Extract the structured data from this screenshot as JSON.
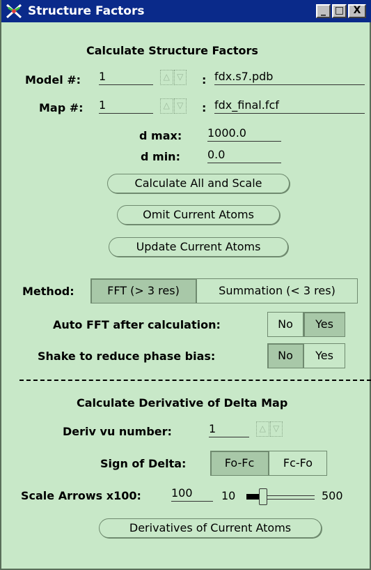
{
  "window": {
    "title": "Structure Factors",
    "btn_min": "_",
    "btn_max": "□",
    "btn_close": "X"
  },
  "section1": {
    "heading": "Calculate Structure Factors",
    "model_label": "Model #:",
    "model_value": "1",
    "model_file": "fdx.s7.pdb",
    "map_label": "Map #:",
    "map_value": "1",
    "map_file": "fdx_final.fcf",
    "colon": ":",
    "dmax_label": "d max:",
    "dmax_value": "1000.0",
    "dmin_label": "d min:",
    "dmin_value": "0.0",
    "btn_calc_all": "Calculate All and Scale",
    "btn_omit": "Omit Current Atoms",
    "btn_update": "Update Current Atoms"
  },
  "method": {
    "label": "Method:",
    "opt1": "FFT (> 3 res)",
    "opt2": "Summation (< 3 res)",
    "selected": "FFT (> 3 res)"
  },
  "auto_fft": {
    "label": "Auto FFT after calculation:",
    "no": "No",
    "yes": "Yes",
    "selected": "Yes"
  },
  "shake": {
    "label": "Shake to reduce phase bias:",
    "no": "No",
    "yes": "Yes",
    "selected": "No"
  },
  "section2": {
    "heading": "Calculate Derivative of Delta Map",
    "deriv_label": "Deriv vu number:",
    "deriv_value": "1",
    "sign_label": "Sign of Delta:",
    "sign_opt1": "Fo-Fc",
    "sign_opt2": "Fc-Fo",
    "sign_selected": "Fo-Fc",
    "scale_label": "Scale Arrows x100:",
    "scale_value": "100",
    "slider_min": "10",
    "slider_max": "500",
    "btn_derivatives": "Derivatives of Current Atoms"
  },
  "spinner_glyphs": {
    "up": "△",
    "down": "▽"
  },
  "colors": {
    "background": "#c8e8c8",
    "titlebar": "#0a2a8a",
    "selected_segment": "#a8c8a8"
  }
}
